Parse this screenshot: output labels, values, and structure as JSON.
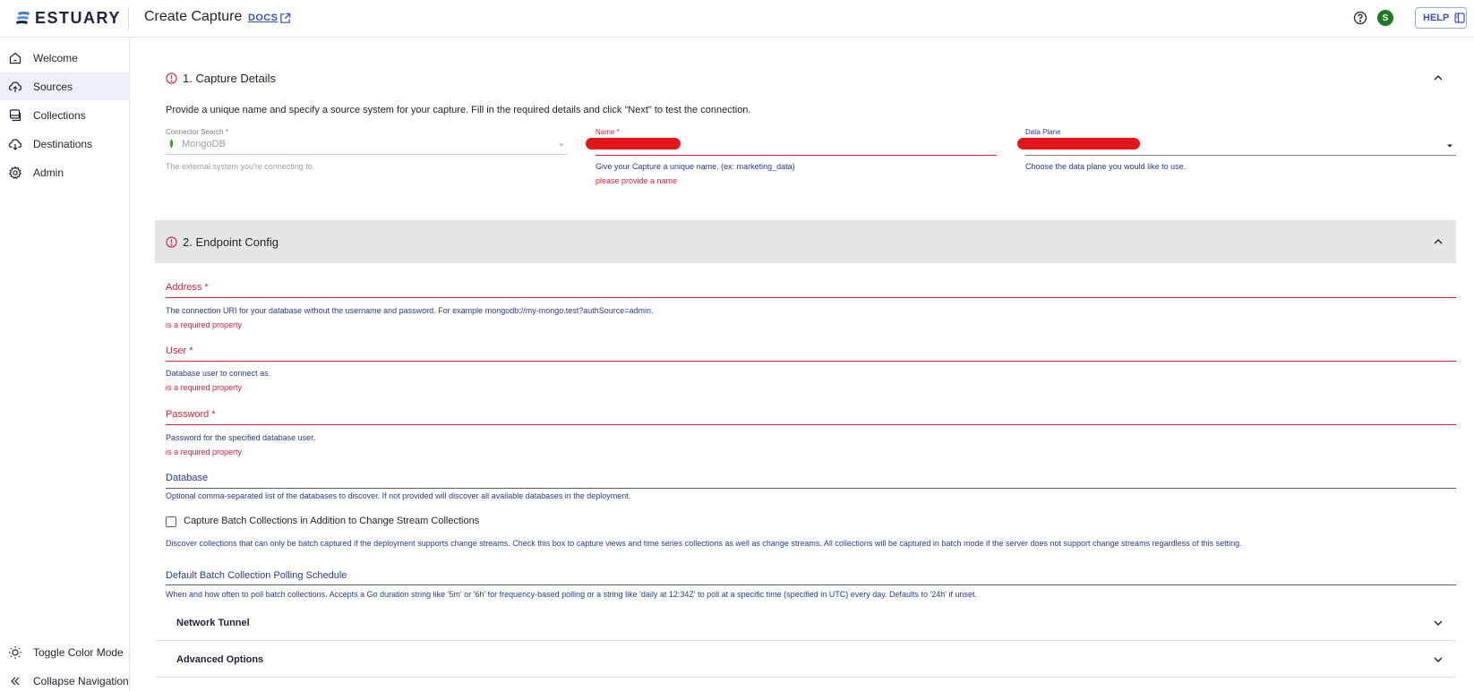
{
  "header": {
    "logo_text": "ESTUARY",
    "page_title": "Create Capture",
    "docs_label": "DOCS",
    "avatar_letter": "S",
    "help_label": "HELP"
  },
  "sidebar": {
    "items": [
      {
        "label": "Welcome",
        "icon": "home-icon"
      },
      {
        "label": "Sources",
        "icon": "cloud-upload-icon"
      },
      {
        "label": "Collections",
        "icon": "collections-icon"
      },
      {
        "label": "Destinations",
        "icon": "cloud-download-icon"
      },
      {
        "label": "Admin",
        "icon": "gear-icon"
      }
    ],
    "bottom": [
      {
        "label": "Toggle Color Mode",
        "icon": "sun-icon"
      },
      {
        "label": "Collapse Navigation",
        "icon": "double-chevron-left-icon"
      }
    ]
  },
  "capture_details": {
    "title": "1. Capture Details",
    "intro": "Provide a unique name and specify a source system for your capture. Fill in the required details and click \"Next\" to test the connection.",
    "connector": {
      "label": "Connector Search *",
      "value": "MongoDB",
      "helper": "The external system you're connecting to."
    },
    "name": {
      "label": "Name *",
      "helper": "Give your Capture a unique name. (ex: marketing_data)",
      "error": "please provide a name"
    },
    "data_plane": {
      "label": "Data Plane",
      "helper": "Choose the data plane you would like to use."
    }
  },
  "endpoint_config": {
    "title": "2. Endpoint Config",
    "address": {
      "label": "Address *",
      "helper": "The connection URI for your database without the username and password. For example mongodb://my-mongo.test?authSource=admin.",
      "error": "is a required property"
    },
    "user": {
      "label": "User *",
      "helper": "Database user to connect as.",
      "error": "is a required property"
    },
    "password": {
      "label": "Password *",
      "helper": "Password for the specified database user.",
      "error": "is a required property"
    },
    "database": {
      "label": "Database",
      "helper": "Optional comma-separated list of the databases to discover. If not provided will discover all available databases in the deployment."
    },
    "batch_checkbox": {
      "label": "Capture Batch Collections in Addition to Change Stream Collections",
      "checked": false,
      "helper": "Discover collections that can only be batch captured if the deployment supports change streams. Check this box to capture views and time series collections as well as change streams. All collections will be captured in batch mode if the server does not support change streams regardless of this setting."
    },
    "polling": {
      "label": "Default Batch Collection Polling Schedule",
      "helper": "When and how often to poll batch collections. Accepts a Go duration string like '5m' or '6h' for frequency-based polling or a string like 'daily at 12:34Z' to poll at a specific time (specified in UTC) every day. Defaults to '24h' if unset."
    },
    "network_tunnel": "Network Tunnel",
    "advanced_options": "Advanced Options"
  },
  "colors": {
    "accent": "#3e4fb5",
    "error": "#d1263c",
    "redaction": "#e4161c",
    "avatar": "#1f7a26"
  }
}
